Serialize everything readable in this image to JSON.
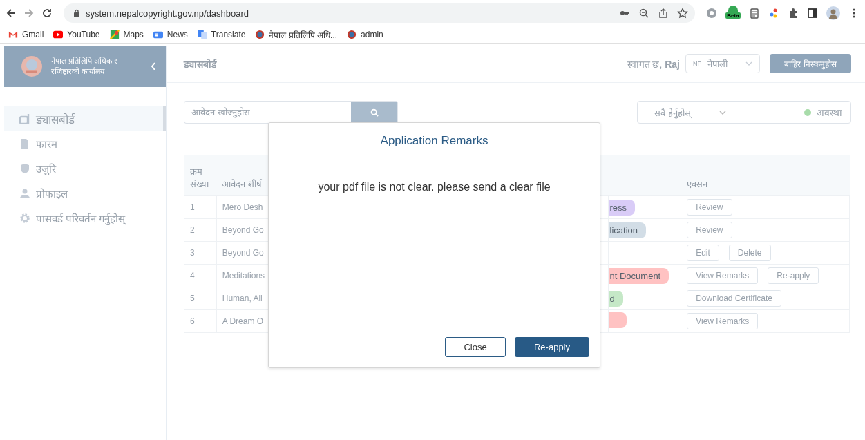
{
  "browser": {
    "url": "system.nepalcopyright.gov.np/dashboard",
    "bookmarks": [
      {
        "label": "Gmail",
        "kind": "gmail"
      },
      {
        "label": "YouTube",
        "kind": "youtube"
      },
      {
        "label": "Maps",
        "kind": "maps"
      },
      {
        "label": "News",
        "kind": "news"
      },
      {
        "label": "Translate",
        "kind": "translate"
      },
      {
        "label": "नेपाल प्रतिलिपि अधि...",
        "kind": "emblem"
      },
      {
        "label": "admin",
        "kind": "emblem"
      }
    ],
    "extension_badge": "Beta"
  },
  "sidebar": {
    "org_lines": [
      "नेपाल प्रतिलिपि अधिकार",
      "रजिष्ट्रारको कार्यालय"
    ],
    "items": [
      {
        "label": "ड्यासबोर्ड",
        "kind": "dashboard",
        "selected": true
      },
      {
        "label": "फारम",
        "kind": "file",
        "selected": false
      },
      {
        "label": "उजुरि",
        "kind": "shield",
        "selected": false
      },
      {
        "label": "प्रोफाइल",
        "kind": "user",
        "selected": false
      },
      {
        "label": "पासवर्ड परिवर्तन गर्नुहोस्",
        "kind": "gear",
        "selected": false
      }
    ]
  },
  "header": {
    "title": "ड्यासबोर्ड",
    "welcome": "स्वागत छ, **Raj**",
    "language": {
      "code": "NP",
      "label": "नेपाली"
    },
    "logout": "बाहिर निस्कनुहोस"
  },
  "search": {
    "placeholder": "आवेदन खोज्नुहोस"
  },
  "filter": {
    "value": "सबै हेर्नुहोस्",
    "status_label": "अवस्था"
  },
  "table": {
    "columns": [
      "क्रम संख्या",
      "आवेदन शीर्ष",
      "",
      "एक्सन"
    ],
    "rows": [
      {
        "sn": "1",
        "title": "Mero Desh",
        "status": {
          "label": "ress",
          "color": "#d9ccf7"
        },
        "actions": [
          "Review"
        ]
      },
      {
        "sn": "2",
        "title": "Beyond Go",
        "status": {
          "label": "lication",
          "color": "#d2dde6"
        },
        "actions": [
          "Review"
        ]
      },
      {
        "sn": "3",
        "title": "Beyond Go",
        "actions": [
          "Edit",
          "Delete"
        ]
      },
      {
        "sn": "4",
        "title": "Meditations",
        "status": {
          "label": "nt Document",
          "color": "#ffc2c2"
        },
        "actions": [
          "View Remarks",
          "Re-apply"
        ]
      },
      {
        "sn": "5",
        "title": "Human, All",
        "status": {
          "label": "d",
          "color": "#c5e8c7"
        },
        "actions": [
          "Download Certificate"
        ]
      },
      {
        "sn": "6",
        "title": "A Dream O",
        "status": {
          "color": "#ffc2c2"
        },
        "actions": [
          "View Remarks"
        ]
      }
    ]
  },
  "modal": {
    "title": "Application Remarks",
    "message": "your pdf file is not clear. please send a clear file",
    "buttons": [
      {
        "label": "Close",
        "kind": "secondary"
      },
      {
        "label": "Re-apply",
        "kind": "primary"
      }
    ]
  }
}
